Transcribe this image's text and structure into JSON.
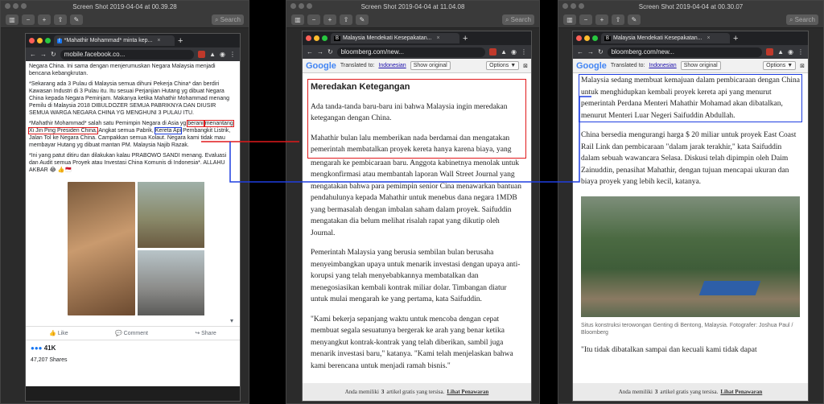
{
  "windows": [
    {
      "title": "Screen Shot 2019-04-04 at 00.39.28",
      "search": "Search"
    },
    {
      "title": "Screen Shot 2019-04-04 at 11.04.08",
      "search": "Search"
    },
    {
      "title": "Screen Shot 2019-04-04 at 00.30.07",
      "search": "Search"
    }
  ],
  "facebook": {
    "tab_title": "*Mahathir Mohammad* minta kep...",
    "url": "mobile.facebook.co...",
    "para1": "Negara China. Ini sama dengan menjerumuskan Negara Malaysia menjadi bencana kebangkrutan.",
    "para2": "*Sekarang ada 3 Pulau di Malaysia semua dihuni Pekerja China* dan berdiri Kawasan Industri di 3 Pulau itu. Itu sesuai Perjanjian Hutang yg dibuat Negara China kepada Negara Peminjam. Makanya ketika Mahathir Mohammad menang Pemilu di Malaysia 2018 DIBULDOZER SEMUA PABRIKNYA DAN DIUSIR SEMUA WARGA NEGARA CHINA YG MENGHUNI 3 PULAU ITU.",
    "para3_a": "*Mahathir Mohammad* salah satu Pemimpin Negara di Asia yg",
    "para3_hl1": "berani",
    "para3_hl2": "menantang Xi Jin Ping Presiden China,",
    "para3_b": "Angkat semua Pabrik,",
    "para3_hl3": "Kereta Api",
    "para3_c": "Pembangkit Listrik, Jalan Tol ke Negara China. Campakkan semua Kolaut. Negara kami tidak mau membayar Hutang yg dibuat mantan PM. Malaysia Najib Razak.",
    "para4": "*Ini yang patut ditiru dan dilakukan kalau PRABOWO SANDI menang. Evaluasi dan Audit semua Proyek atau Investasi China Komunis di Indonesia*. ALLAHU AKBAR 😂 👍🇲🇨",
    "like": "Like",
    "comment": "Comment",
    "share": "Share",
    "reactions": "41K",
    "shares": "47,207 Shares"
  },
  "bloomberg_mid": {
    "tab_title": "Malaysia Mendekati Kesepakatan...",
    "url": "bloomberg.com/new...",
    "translated_to": "Translated to:",
    "lang": "Indonesian",
    "show_original": "Show original",
    "options": "Options ▼",
    "heading": "Meredakan Ketegangan",
    "p1": "Ada tanda-tanda baru-baru ini bahwa Malaysia ingin meredakan ketegangan dengan China.",
    "p2_hl": "Mahathir bulan lalu memberikan nada berdamai dan mengatakan pemerintah membatalkan proyek kereta hanya karena biaya, yang",
    "p2_rest": "mengarah ke pembicaraan baru. Anggota kabinetnya menolak untuk mengkonfirmasi atau membantah laporan Wall Street Journal yang mengatakan bahwa para pemimpin senior Cina menawarkan bantuan pendahulunya kepada Mahathir untuk menebus dana negara 1MDB yang bermasalah dengan imbalan saham dalam proyek. Saifuddin mengatakan dia belum melihat risalah rapat yang dikutip oleh Journal.",
    "p3": "Pemerintah Malaysia yang berusia sembilan bulan berusaha menyeimbangkan upaya untuk menarik investasi dengan upaya anti-korupsi yang telah menyebabkannya membatalkan dan menegosiasikan kembali kontrak miliar dolar. Timbangan diatur untuk mulai mengarah ke yang pertama, kata Saifuddin.",
    "p4": "\"Kami bekerja sepanjang waktu untuk mencoba dengan cepat membuat segala sesuatunya bergerak ke arah yang benar ketika menyangkut kontrak-kontrak yang telah diberikan, sambil juga menarik investasi baru,\" katanya. \"Kami telah menjelaskan bahwa kami berencana untuk menjadi ramah bisnis.\"",
    "footer_a": "Anda memiliki",
    "footer_n": "3",
    "footer_b": "artikel gratis yang tersisa.",
    "footer_link": "Lihat Penawaran"
  },
  "bloomberg_right": {
    "tab_title": "Malaysia Mendekati Kesepakatan...",
    "url": "bloomberg.com/new...",
    "translated_to": "Translated to:",
    "lang": "Indonesian",
    "show_original": "Show original",
    "options": "Options ▼",
    "p1_hl": "Malaysia sedang membuat kemajuan dalam pembicaraan dengan China untuk menghidupkan kembali proyek kereta api yang menurut pemerintah Perdana Menteri Mahathir Mohamad akan dibatalkan, menurut Menteri Luar Negeri Saifuddin Abdullah.",
    "p2": "China bersedia mengurangi harga $ 20 miliar untuk proyek East Coast Rail Link dan pembicaraan \"dalam jarak terakhir,\" kata Saifuddin dalam sebuah wawancara Selasa. Diskusi telah dipimpin oleh Daim Zainuddin, penasihat Mahathir, dengan tujuan mencapai ukuran dan biaya proyek yang lebih kecil, katanya.",
    "caption": "Situs konstruksi terowongan Genting di Bentong, Malaysia. Fotografer: Joshua Paul / Bloomberg",
    "p3": "\"Itu tidak dibatalkan sampai dan kecuali kami tidak dapat",
    "footer_a": "Anda memiliki",
    "footer_n": "3",
    "footer_b": "artikel gratis yang tersisa.",
    "footer_link": "Lihat Penawaran"
  },
  "google": "Google"
}
